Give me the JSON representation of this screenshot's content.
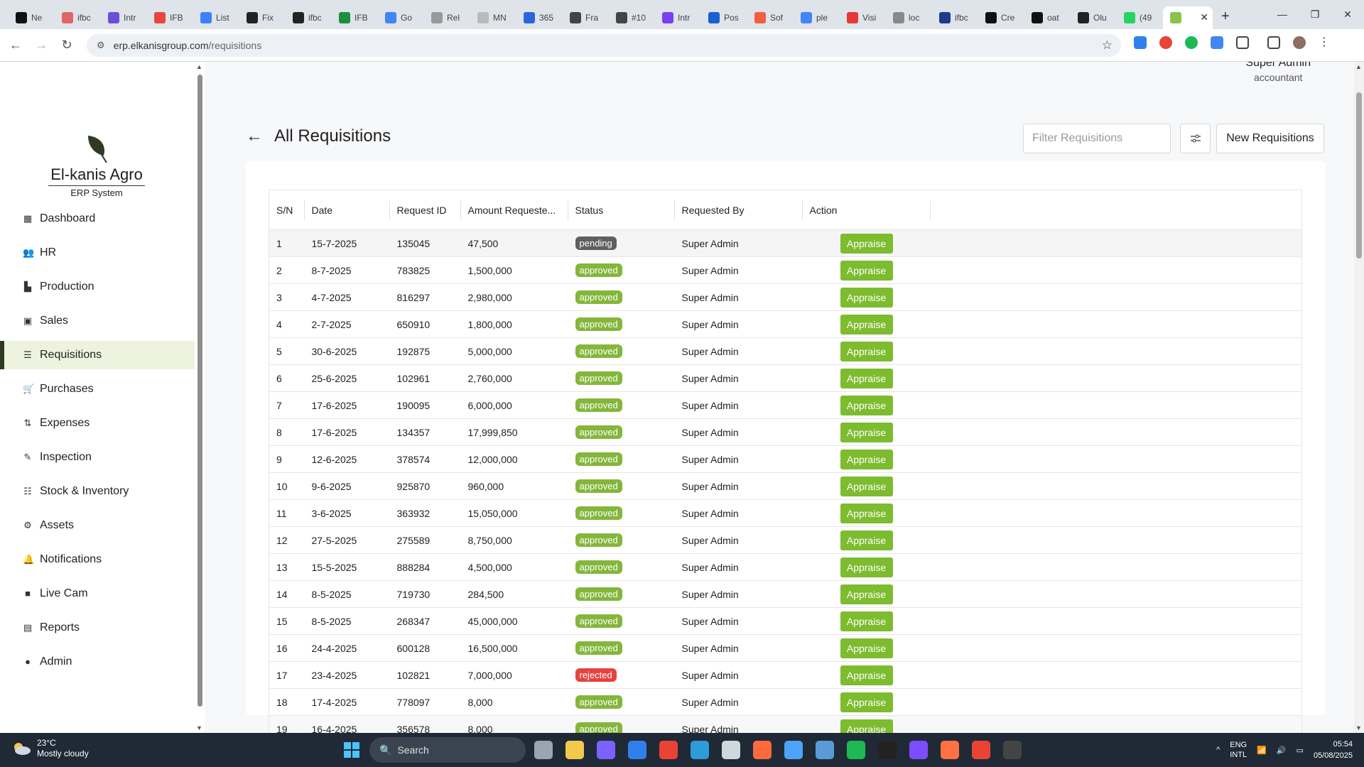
{
  "browser": {
    "tabs": [
      "Ne",
      "ifbc",
      "Intr",
      "IFB",
      "List",
      "Fix",
      "ifbc",
      "IFB",
      "Go",
      "Rel",
      "MN",
      "365",
      "Fra",
      "#10",
      "Intr",
      "Pos",
      "Sof",
      "ple",
      "Visi",
      "loc",
      "ifbc",
      "Cre",
      "oat",
      "Olu",
      "(49",
      ""
    ],
    "tab_colors": [
      "#111111",
      "#e06666",
      "#6b4fd8",
      "#e8453c",
      "#3b82f6",
      "#222222",
      "#222222",
      "#1e8e3e",
      "#4285f4",
      "#999999",
      "#bbbbbb",
      "#2b65d9",
      "#444444",
      "#444444",
      "#7b3ff2",
      "#1a5fd0",
      "#f06040",
      "#4285f4",
      "#e53935",
      "#888888",
      "#1e3a8a",
      "#111111",
      "#111111",
      "#222222",
      "#25d366",
      "#8bc34a"
    ],
    "url_domain": "erp.elkanisgroup.com",
    "url_path": "/requisitions"
  },
  "user": {
    "name": "Super Admin",
    "role": "accountant"
  },
  "logo": {
    "brand": "El-kanis Agro",
    "subtitle": "ERP System"
  },
  "sidebar": {
    "items": [
      {
        "label": "Dashboard",
        "icon": "dashboard-icon",
        "glyph": "▦"
      },
      {
        "label": "HR",
        "icon": "people-icon",
        "glyph": "👥"
      },
      {
        "label": "Production",
        "icon": "factory-icon",
        "glyph": "▙"
      },
      {
        "label": "Sales",
        "icon": "money-icon",
        "glyph": "▣"
      },
      {
        "label": "Requisitions",
        "icon": "list-icon",
        "glyph": "☰"
      },
      {
        "label": "Purchases",
        "icon": "cart-icon",
        "glyph": "🛒"
      },
      {
        "label": "Expenses",
        "icon": "expenses-icon",
        "glyph": "⇅"
      },
      {
        "label": "Inspection",
        "icon": "inspection-icon",
        "glyph": "✎"
      },
      {
        "label": "Stock & Inventory",
        "icon": "database-icon",
        "glyph": "☷"
      },
      {
        "label": "Assets",
        "icon": "assets-icon",
        "glyph": "⚙"
      },
      {
        "label": "Notifications",
        "icon": "bell-icon",
        "glyph": "🔔"
      },
      {
        "label": "Live Cam",
        "icon": "camera-icon",
        "glyph": "■"
      },
      {
        "label": "Reports",
        "icon": "reports-icon",
        "glyph": "▤"
      },
      {
        "label": "Admin",
        "icon": "admin-icon",
        "glyph": "●"
      }
    ],
    "active": "Requisitions"
  },
  "header": {
    "title": "All Requisitions",
    "filter_placeholder": "Filter Requisitions",
    "new_button": "New Requisitions"
  },
  "table": {
    "columns": [
      "S/N",
      "Date",
      "Request ID",
      "Amount Requeste...",
      "Status",
      "Requested By",
      "Action"
    ],
    "action_label": "Appraise",
    "rows": [
      {
        "sn": "1",
        "date": "15-7-2025",
        "id": "135045",
        "amount": "47,500",
        "status": "pending",
        "by": "Super Admin"
      },
      {
        "sn": "2",
        "date": "8-7-2025",
        "id": "783825",
        "amount": "1,500,000",
        "status": "approved",
        "by": "Super Admin"
      },
      {
        "sn": "3",
        "date": "4-7-2025",
        "id": "816297",
        "amount": "2,980,000",
        "status": "approved",
        "by": "Super Admin"
      },
      {
        "sn": "4",
        "date": "2-7-2025",
        "id": "650910",
        "amount": "1,800,000",
        "status": "approved",
        "by": "Super Admin"
      },
      {
        "sn": "5",
        "date": "30-6-2025",
        "id": "192875",
        "amount": "5,000,000",
        "status": "approved",
        "by": "Super Admin"
      },
      {
        "sn": "6",
        "date": "25-6-2025",
        "id": "102961",
        "amount": "2,760,000",
        "status": "approved",
        "by": "Super Admin"
      },
      {
        "sn": "7",
        "date": "17-6-2025",
        "id": "190095",
        "amount": "6,000,000",
        "status": "approved",
        "by": "Super Admin"
      },
      {
        "sn": "8",
        "date": "17-6-2025",
        "id": "134357",
        "amount": "17,999,850",
        "status": "approved",
        "by": "Super Admin"
      },
      {
        "sn": "9",
        "date": "12-6-2025",
        "id": "378574",
        "amount": "12,000,000",
        "status": "approved",
        "by": "Super Admin"
      },
      {
        "sn": "10",
        "date": "9-6-2025",
        "id": "925870",
        "amount": "960,000",
        "status": "approved",
        "by": "Super Admin"
      },
      {
        "sn": "11",
        "date": "3-6-2025",
        "id": "363932",
        "amount": "15,050,000",
        "status": "approved",
        "by": "Super Admin"
      },
      {
        "sn": "12",
        "date": "27-5-2025",
        "id": "275589",
        "amount": "8,750,000",
        "status": "approved",
        "by": "Super Admin"
      },
      {
        "sn": "13",
        "date": "15-5-2025",
        "id": "888284",
        "amount": "4,500,000",
        "status": "approved",
        "by": "Super Admin"
      },
      {
        "sn": "14",
        "date": "8-5-2025",
        "id": "719730",
        "amount": "284,500",
        "status": "approved",
        "by": "Super Admin"
      },
      {
        "sn": "15",
        "date": "8-5-2025",
        "id": "268347",
        "amount": "45,000,000",
        "status": "approved",
        "by": "Super Admin"
      },
      {
        "sn": "16",
        "date": "24-4-2025",
        "id": "600128",
        "amount": "16,500,000",
        "status": "approved",
        "by": "Super Admin"
      },
      {
        "sn": "17",
        "date": "23-4-2025",
        "id": "102821",
        "amount": "7,000,000",
        "status": "rejected",
        "by": "Super Admin"
      },
      {
        "sn": "18",
        "date": "17-4-2025",
        "id": "778097",
        "amount": "8,000",
        "status": "approved",
        "by": "Super Admin"
      },
      {
        "sn": "19",
        "date": "16-4-2025",
        "id": "356578",
        "amount": "8,000",
        "status": "approved",
        "by": "Super Admin"
      }
    ]
  },
  "taskbar": {
    "temperature": "23°C",
    "weather": "Mostly cloudy",
    "search": "Search",
    "lang1": "ENG",
    "lang2": "INTL",
    "time": "05:54",
    "date": "05/08/2025",
    "app_colors": [
      "#9aa5b1",
      "#f2c94c",
      "#7b61ff",
      "#2f80ed",
      "#ea4335",
      "#2d9cdb",
      "#cfd8dc",
      "#ff6a3d",
      "#4fa3f7",
      "#5b9bd5",
      "#1db954",
      "#222222",
      "#7c4dff",
      "#ff7043",
      "#ea4335",
      "#444444"
    ]
  },
  "colors": {
    "accent_green": "#7dbb2f",
    "approved": "#84b63b",
    "pending": "#5f5f5f",
    "rejected": "#e5433f"
  }
}
